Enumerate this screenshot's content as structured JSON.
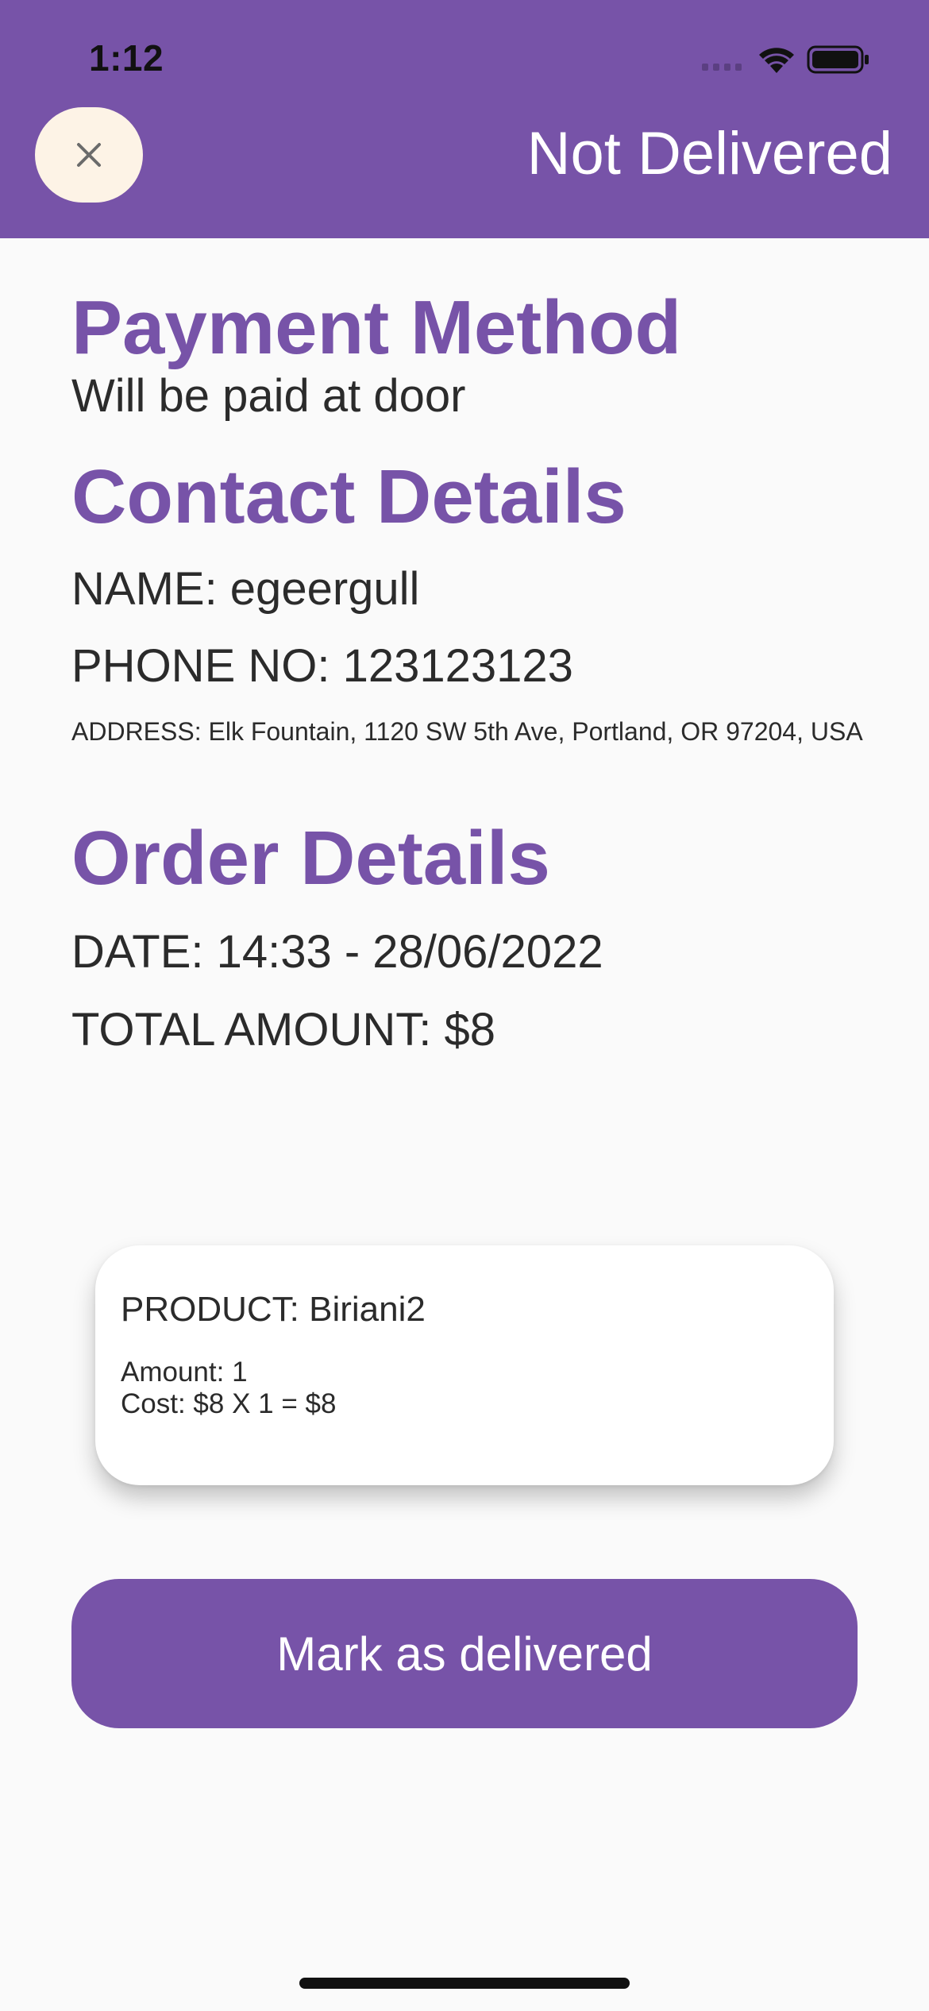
{
  "status_bar": {
    "time": "1:12",
    "icons": [
      "cellular-signal-icon",
      "wifi-icon",
      "battery-icon"
    ]
  },
  "header": {
    "close_icon": "close-icon",
    "title": "Not Delivered",
    "background_color": "#7753a8",
    "close_button_color": "#fdf3e6"
  },
  "payment": {
    "title": "Payment Method",
    "method": "Will be paid at door"
  },
  "contact": {
    "title": "Contact Details",
    "name": "NAME: egeergull",
    "phone": "PHONE NO: 123123123",
    "address": "ADDRESS: Elk Fountain, 1120 SW 5th Ave, Portland, OR 97204, USA"
  },
  "order": {
    "title": "Order Details",
    "date": "DATE: 14:33 - 28/06/2022",
    "total": "TOTAL AMOUNT: $8"
  },
  "products": [
    {
      "name": "PRODUCT: Biriani2",
      "amount": "Amount: 1",
      "cost": "Cost: $8 X 1 = $8"
    }
  ],
  "actions": {
    "mark_delivered_label": "Mark as delivered"
  },
  "colors": {
    "accent": "#7753a8",
    "text": "#2b2b2b",
    "background": "#fafafa"
  }
}
